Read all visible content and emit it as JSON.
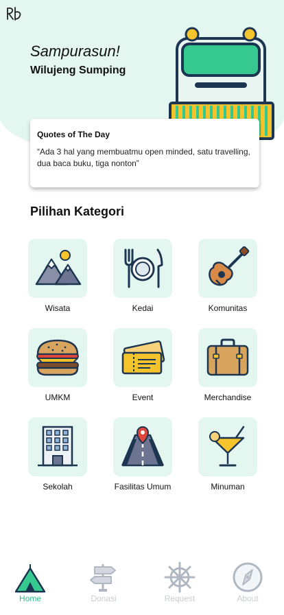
{
  "header": {
    "greeting": "Sampurasun!",
    "welcome": "Wilujeng Sumping"
  },
  "quote": {
    "title": "Quotes of The Day",
    "text": "“Ada 3 hal yang membuatmu open minded, satu travelling, dua baca buku, tiga nonton”"
  },
  "categories_section": {
    "title": "Pilihan Kategori",
    "items": [
      {
        "label": "Wisata",
        "icon": "mountains-icon"
      },
      {
        "label": "Kedai",
        "icon": "plate-cutlery-icon"
      },
      {
        "label": "Komunitas",
        "icon": "guitar-icon"
      },
      {
        "label": "UMKM",
        "icon": "burger-icon"
      },
      {
        "label": "Event",
        "icon": "ticket-icon"
      },
      {
        "label": "Merchandise",
        "icon": "suitcase-icon"
      },
      {
        "label": "Sekolah",
        "icon": "building-icon"
      },
      {
        "label": "Fasilitas Umum",
        "icon": "road-pin-icon"
      },
      {
        "label": "Minuman",
        "icon": "cocktail-icon"
      }
    ]
  },
  "tabbar": {
    "active": "Home",
    "items": [
      {
        "label": "Home",
        "icon": "tent-icon"
      },
      {
        "label": "Donasi",
        "icon": "signpost-icon"
      },
      {
        "label": "Request",
        "icon": "ship-wheel-icon"
      },
      {
        "label": "About",
        "icon": "compass-icon"
      }
    ]
  },
  "colors": {
    "accent": "#2ebd8a",
    "mint_bg": "#e3f7f0",
    "inactive_tab": "#c6ccd3"
  }
}
